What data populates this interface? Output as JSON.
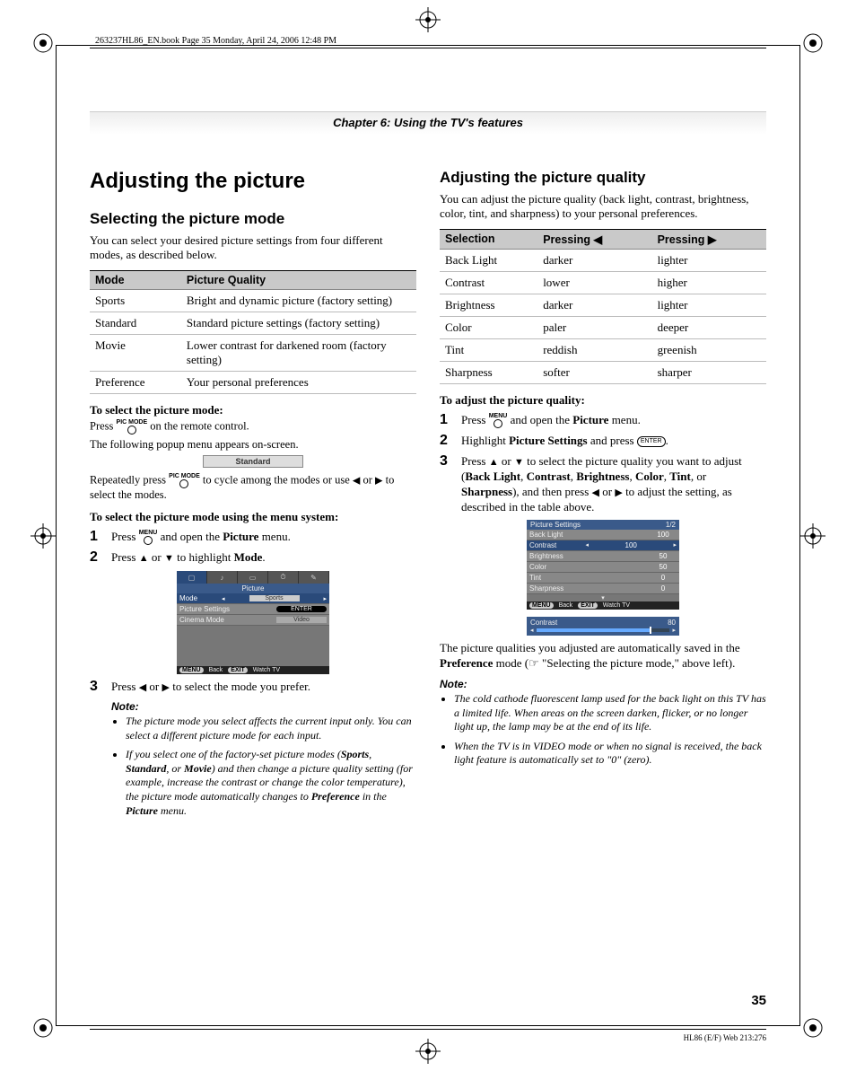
{
  "header": "263237HL86_EN.book  Page 35  Monday, April 24, 2006  12:48 PM",
  "chapter": "Chapter 6: Using the TV's features",
  "left": {
    "h1": "Adjusting the picture",
    "h2": "Selecting the picture mode",
    "intro": "You can select your desired picture settings from four different modes, as described below.",
    "table_h1": "Mode",
    "table_h2": "Picture Quality",
    "rows": [
      {
        "m": "Sports",
        "q": "Bright and dynamic picture (factory setting)"
      },
      {
        "m": "Standard",
        "q": "Standard picture settings (factory setting)"
      },
      {
        "m": "Movie",
        "q": "Lower contrast for darkened room (factory setting)"
      },
      {
        "m": "Preference",
        "q": "Your personal preferences"
      }
    ],
    "sel_head": "To select the picture mode:",
    "press1a": "Press ",
    "picmode": "PIC MODE",
    "press1b": " on the remote control.",
    "popup_line": "The following popup menu appears on-screen.",
    "popup_val": "Standard",
    "repeat_a": "Repeatedly press ",
    "repeat_b": " to cycle among the modes or use ",
    "repeat_c": " to select the modes.",
    "menu_head": "To select the picture mode using the menu system:",
    "s1a": "Press ",
    "menu_btn": "MENU",
    "s1b": " and open the ",
    "s1c": "Picture",
    "s1d": " menu.",
    "s2a": "Press ",
    "s2b": " or ",
    "s2c": " to highlight ",
    "s2d": "Mode",
    "s2e": ".",
    "osd": {
      "title": "Picture",
      "r1": "Mode",
      "r1v": "Sports",
      "r2": "Picture Settings",
      "r2v": "ENTER",
      "r3": "Cinema Mode",
      "r3v": "Video",
      "back": "Back",
      "watch": "Watch TV",
      "menu_pill": "MENU",
      "exit_pill": "EXIT"
    },
    "s3a": "Press ",
    "s3b": " or ",
    "s3c": "  to select the mode you prefer.",
    "note": "Note:",
    "n1a": "The picture mode you select affects the current input only. You can select a different picture mode for each input.",
    "n2a": "If you select one of the factory-set picture modes (",
    "n2b": "Sports",
    "n2c": ", ",
    "n2d": "Standard",
    "n2e": ", or ",
    "n2f": "Movie",
    "n2g": ") and then change a picture quality setting (for example, increase the contrast or change the color temperature), the picture mode automatically changes to ",
    "n2h": "Preference",
    "n2i": " in the ",
    "n2j": "Picture",
    "n2k": " menu."
  },
  "right": {
    "h2": "Adjusting the picture quality",
    "intro": "You can adjust the picture quality (back light, contrast, brightness, color, tint, and sharpness) to your personal preferences.",
    "th1": "Selection",
    "th2": "Pressing ◀",
    "th3": "Pressing ▶",
    "rows": [
      {
        "s": "Back Light",
        "l": "darker",
        "r": "lighter"
      },
      {
        "s": "Contrast",
        "l": "lower",
        "r": "higher"
      },
      {
        "s": "Brightness",
        "l": "darker",
        "r": "lighter"
      },
      {
        "s": "Color",
        "l": "paler",
        "r": "deeper"
      },
      {
        "s": "Tint",
        "l": "reddish",
        "r": "greenish"
      },
      {
        "s": "Sharpness",
        "l": "softer",
        "r": "sharper"
      }
    ],
    "adj_head": "To adjust the picture quality:",
    "s1a": "Press ",
    "s1b": " and open the ",
    "s1c": "Picture",
    "s1d": " menu.",
    "s2a": "Highlight ",
    "s2b": "Picture Settings",
    "s2c": " and press ",
    "s2d": ".",
    "s3a": "Press ",
    "s3b": " or ",
    "s3c": " to select the picture quality you want to adjust (",
    "s3list": "Back Light, Contrast, Brightness, Color, Tint, ",
    "s3or": "or ",
    "s3sharp": "Sharpness",
    "s3d": "), and then press ",
    "s3e": " or ",
    "s3f": " to adjust the setting, as described in the table above.",
    "osd": {
      "title": "Picture Settings",
      "page": "1/2",
      "r": [
        {
          "n": "Back Light",
          "v": "100"
        },
        {
          "n": "Contrast",
          "v": "100"
        },
        {
          "n": "Brightness",
          "v": "50"
        },
        {
          "n": "Color",
          "v": "50"
        },
        {
          "n": "Tint",
          "v": "0"
        },
        {
          "n": "Sharpness",
          "v": "0"
        }
      ],
      "back": "Back",
      "watch": "Watch TV",
      "menu_pill": "MENU",
      "exit_pill": "EXIT",
      "slider_name": "Contrast",
      "slider_val": "80"
    },
    "autosave_a": "The picture qualities you adjusted are automatically saved in the ",
    "autosave_b": "Preference",
    "autosave_c": " mode (☞ \"Selecting the picture mode,\" above left).",
    "note": "Note:",
    "n1": "The cold cathode fluorescent lamp used for the back light on this TV has a limited life. When areas on the screen darken, flicker, or no longer light up, the lamp may be at the end of its life.",
    "n2": "When the TV is in VIDEO mode or when no signal is received, the back light feature is automatically set to \"0\" (zero)."
  },
  "pagenum": "35",
  "footer": "HL86 (E/F) Web 213:276",
  "chart_data": {
    "type": "table",
    "tables": [
      {
        "title": "Picture mode quality",
        "columns": [
          "Mode",
          "Picture Quality"
        ],
        "rows": [
          [
            "Sports",
            "Bright and dynamic picture (factory setting)"
          ],
          [
            "Standard",
            "Standard picture settings (factory setting)"
          ],
          [
            "Movie",
            "Lower contrast for darkened room (factory setting)"
          ],
          [
            "Preference",
            "Your personal preferences"
          ]
        ]
      },
      {
        "title": "Picture quality adjustment directions",
        "columns": [
          "Selection",
          "Pressing ◀",
          "Pressing ▶"
        ],
        "rows": [
          [
            "Back Light",
            "darker",
            "lighter"
          ],
          [
            "Contrast",
            "lower",
            "higher"
          ],
          [
            "Brightness",
            "darker",
            "lighter"
          ],
          [
            "Color",
            "paler",
            "deeper"
          ],
          [
            "Tint",
            "reddish",
            "greenish"
          ],
          [
            "Sharpness",
            "softer",
            "sharper"
          ]
        ]
      },
      {
        "title": "Picture Settings OSD values",
        "columns": [
          "Setting",
          "Value"
        ],
        "rows": [
          [
            "Back Light",
            100
          ],
          [
            "Contrast",
            100
          ],
          [
            "Brightness",
            50
          ],
          [
            "Color",
            50
          ],
          [
            "Tint",
            0
          ],
          [
            "Sharpness",
            0
          ]
        ],
        "slider": {
          "name": "Contrast",
          "value": 80,
          "range": [
            0,
            100
          ]
        }
      }
    ]
  }
}
